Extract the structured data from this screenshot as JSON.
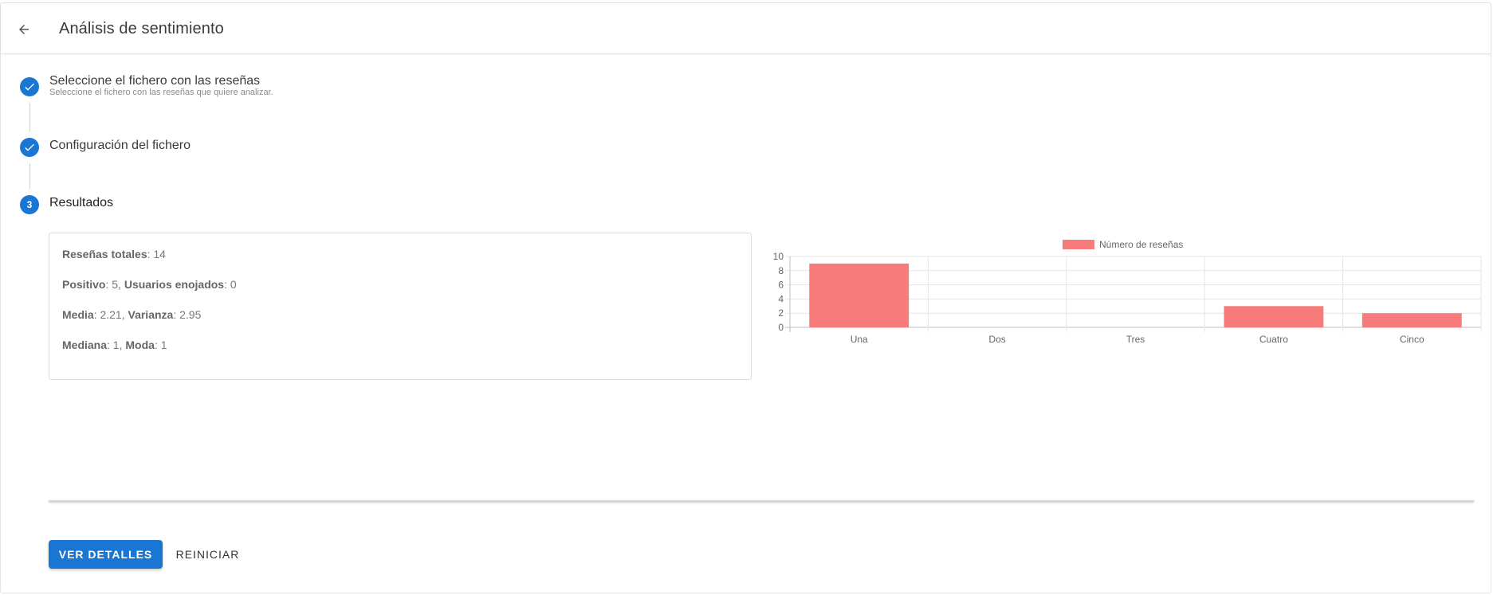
{
  "header": {
    "title": "Análisis de sentimiento",
    "back_icon": "arrow-left-icon"
  },
  "steps": [
    {
      "number": "1",
      "label": "Seleccione el fichero con las reseñas",
      "sublabel": "Seleccione el fichero con las reseñas que quiere analizar.",
      "state": "completed",
      "icon": "check-icon"
    },
    {
      "number": "2",
      "label": "Configuración del fichero",
      "state": "completed",
      "icon": "check-icon"
    },
    {
      "number": "3",
      "label": "Resultados",
      "state": "active"
    }
  ],
  "stats": {
    "total_label": "Reseñas totales",
    "total_value": ": 14",
    "positive_label": "Positivo",
    "positive_value": ": 5, ",
    "angry_label": "Usuarios enojados",
    "angry_value": ": 0",
    "mean_label": "Media",
    "mean_value": ": 2.21, ",
    "variance_label": "Varianza",
    "variance_value": ": 2.95",
    "median_label": "Mediana",
    "median_value": ": 1, ",
    "mode_label": "Moda",
    "mode_value": ": 1"
  },
  "chart_data": {
    "type": "bar",
    "categories": [
      "Una",
      "Dos",
      "Tres",
      "Cuatro",
      "Cinco"
    ],
    "series": [
      {
        "name": "Número de reseñas",
        "values": [
          9,
          0,
          0,
          3,
          2
        ],
        "color": "#f77b7b"
      }
    ],
    "ylim": [
      0,
      10
    ],
    "yticks": [
      "0",
      "2",
      "4",
      "6",
      "8",
      "10"
    ],
    "grid": true,
    "legend": "top-center"
  },
  "actions": {
    "details_label": "VER DETALLES",
    "reset_label": "REINICIAR"
  },
  "colors": {
    "primary": "#1976d2",
    "bar": "#f77b7b"
  }
}
